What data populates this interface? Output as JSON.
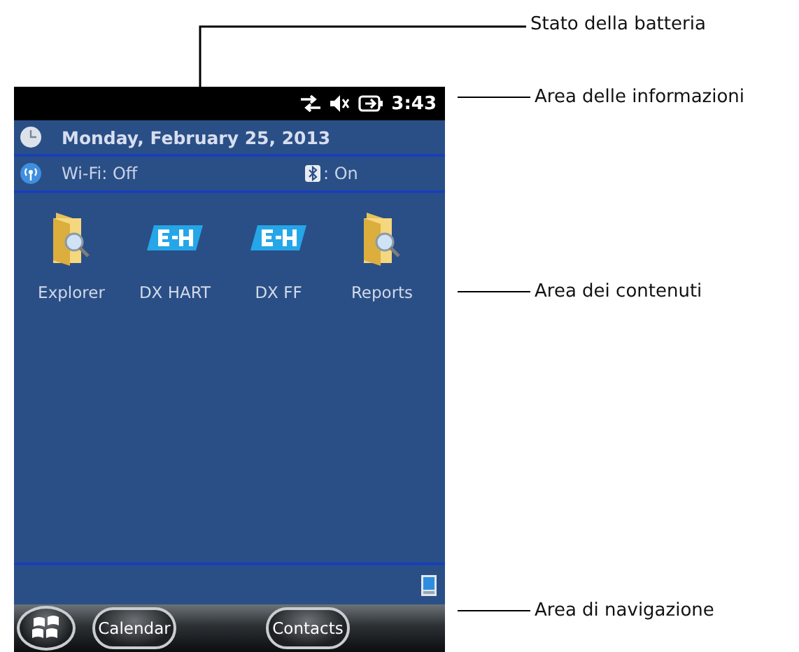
{
  "status_bar": {
    "time": "3:43"
  },
  "info": {
    "date": "Monday, February 25, 2013",
    "wifi": "Wi-Fi: Off",
    "bluetooth": ": On"
  },
  "apps": [
    {
      "label": "Explorer",
      "kind": "folder"
    },
    {
      "label": "DX HART",
      "kind": "logo"
    },
    {
      "label": "DX FF",
      "kind": "logo"
    },
    {
      "label": "Reports",
      "kind": "folder"
    }
  ],
  "nav": [
    {
      "kind": "start"
    },
    {
      "kind": "text",
      "label": "Calendar"
    },
    {
      "kind": "text",
      "label": "Contacts"
    }
  ],
  "callouts": [
    {
      "label": "Stato della batteria",
      "kind": "elbow"
    },
    {
      "label": "Area delle informazioni",
      "kind": "straight"
    },
    {
      "label": "Area dei contenuti",
      "kind": "straight"
    },
    {
      "label": "Area di navigazione",
      "kind": "straight"
    }
  ]
}
